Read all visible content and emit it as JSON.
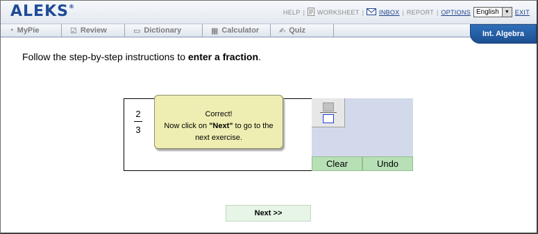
{
  "header": {
    "logo": "ALEKS",
    "logo_mark": "®",
    "links": {
      "help": "HELP",
      "worksheet": "WORKSHEET",
      "inbox": "INBOX",
      "report": "REPORT",
      "options": "OPTIONS",
      "exit": "EXIT"
    },
    "language": "English"
  },
  "nav": {
    "tabs": [
      {
        "label": "MyPie",
        "icon": "pie-icon"
      },
      {
        "label": "Review",
        "icon": "checkbox-icon"
      },
      {
        "label": "Dictionary",
        "icon": "book-icon"
      },
      {
        "label": "Calculator",
        "icon": "calculator-icon"
      },
      {
        "label": "Quiz",
        "icon": "quiz-icon"
      }
    ],
    "course": "Int. Algebra"
  },
  "instruction": {
    "prefix": "Follow the step-by-step instructions to ",
    "bold": "enter a fraction",
    "suffix": "."
  },
  "answer": {
    "numerator": "2",
    "denominator": "3"
  },
  "keypad": {
    "fraction_button": "fraction-template-icon",
    "clear": "Clear",
    "undo": "Undo"
  },
  "popup": {
    "line1": "Correct!",
    "line2_prefix": "Now click on ",
    "line2_bold": "\"Next\"",
    "line2_suffix": " to go to the",
    "line3": "next exercise."
  },
  "next_button": "Next >>",
  "colors": {
    "brand_blue": "#1f4b97",
    "course_tab": "#2f6fb9",
    "popup_bg": "#eeeeb2",
    "keypad_bg": "#d2d9ea",
    "keypad_button": "#b8e0b6",
    "next_button_bg": "#e6f5e6"
  }
}
